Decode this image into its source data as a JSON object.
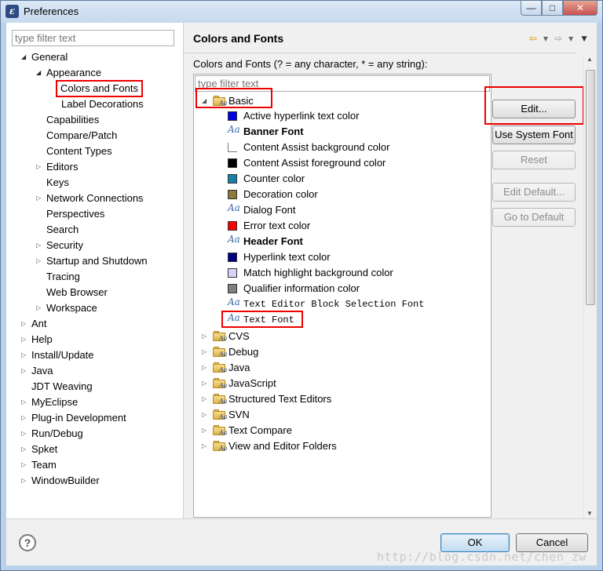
{
  "window": {
    "title": "Preferences",
    "controls": [
      "—",
      "□",
      "✕"
    ]
  },
  "left": {
    "filter_placeholder": "type filter text",
    "tree": [
      {
        "label": "General",
        "level": 0,
        "twisty": "open"
      },
      {
        "label": "Appearance",
        "level": 1,
        "twisty": "open"
      },
      {
        "label": "Colors and Fonts",
        "level": 2,
        "twisty": "none",
        "selected": true
      },
      {
        "label": "Label Decorations",
        "level": 2,
        "twisty": "none"
      },
      {
        "label": "Capabilities",
        "level": 1,
        "twisty": "none"
      },
      {
        "label": "Compare/Patch",
        "level": 1,
        "twisty": "none"
      },
      {
        "label": "Content Types",
        "level": 1,
        "twisty": "none"
      },
      {
        "label": "Editors",
        "level": 1,
        "twisty": "closed"
      },
      {
        "label": "Keys",
        "level": 1,
        "twisty": "none"
      },
      {
        "label": "Network Connections",
        "level": 1,
        "twisty": "closed"
      },
      {
        "label": "Perspectives",
        "level": 1,
        "twisty": "none"
      },
      {
        "label": "Search",
        "level": 1,
        "twisty": "none"
      },
      {
        "label": "Security",
        "level": 1,
        "twisty": "closed"
      },
      {
        "label": "Startup and Shutdown",
        "level": 1,
        "twisty": "closed"
      },
      {
        "label": "Tracing",
        "level": 1,
        "twisty": "none"
      },
      {
        "label": "Web Browser",
        "level": 1,
        "twisty": "none"
      },
      {
        "label": "Workspace",
        "level": 1,
        "twisty": "closed"
      },
      {
        "label": "Ant",
        "level": 0,
        "twisty": "closed"
      },
      {
        "label": "Help",
        "level": 0,
        "twisty": "closed"
      },
      {
        "label": "Install/Update",
        "level": 0,
        "twisty": "closed"
      },
      {
        "label": "Java",
        "level": 0,
        "twisty": "closed"
      },
      {
        "label": "JDT Weaving",
        "level": 0,
        "twisty": "none"
      },
      {
        "label": "MyEclipse",
        "level": 0,
        "twisty": "closed"
      },
      {
        "label": "Plug-in Development",
        "level": 0,
        "twisty": "closed"
      },
      {
        "label": "Run/Debug",
        "level": 0,
        "twisty": "closed"
      },
      {
        "label": "Spket",
        "level": 0,
        "twisty": "closed"
      },
      {
        "label": "Team",
        "level": 0,
        "twisty": "closed"
      },
      {
        "label": "WindowBuilder",
        "level": 0,
        "twisty": "closed"
      }
    ]
  },
  "right": {
    "title": "Colors and Fonts",
    "description": "Colors and Fonts (? = any character, * = any string):",
    "filter_placeholder": "type filter text",
    "basic_label": "Basic",
    "basic_items": [
      {
        "label": "Active hyperlink text color",
        "kind": "color",
        "color": "#0000e0"
      },
      {
        "label": "Banner Font",
        "kind": "font",
        "bold": true
      },
      {
        "label": "Content Assist background color",
        "kind": "color",
        "color": "#ffffff"
      },
      {
        "label": "Content Assist foreground color",
        "kind": "color",
        "color": "#000000"
      },
      {
        "label": "Counter color",
        "kind": "color",
        "color": "#1a7fa8"
      },
      {
        "label": "Decoration color",
        "kind": "color",
        "color": "#8c7a3a"
      },
      {
        "label": "Dialog Font",
        "kind": "font"
      },
      {
        "label": "Error text color",
        "kind": "color",
        "color": "#ff0000"
      },
      {
        "label": "Header Font",
        "kind": "font",
        "bold": true
      },
      {
        "label": "Hyperlink text color",
        "kind": "color",
        "color": "#000080"
      },
      {
        "label": "Match highlight background color",
        "kind": "color",
        "color": "#d4d4f4"
      },
      {
        "label": "Qualifier information color",
        "kind": "color",
        "color": "#808080"
      },
      {
        "label": "Text Editor Block Selection Font",
        "kind": "font",
        "mono": true
      },
      {
        "label": "Text Font",
        "kind": "font",
        "mono": true
      }
    ],
    "categories": [
      "CVS",
      "Debug",
      "Java",
      "JavaScript",
      "Structured Text Editors",
      "SVN",
      "Text Compare",
      "View and Editor Folders"
    ],
    "font_icon_text": "Aa",
    "buttons": {
      "edit": "Edit...",
      "use_system_font": "Use System Font",
      "reset": "Reset",
      "edit_default": "Edit Default...",
      "go_to_default": "Go to Default"
    }
  },
  "footer": {
    "help_icon": "?",
    "ok": "OK",
    "cancel": "Cancel",
    "watermark": "http://blog.csdn.net/chen_zw"
  },
  "colors": {
    "highlight_red": "#e00000",
    "window_frame": "#b9d1ea",
    "dialog_bg": "#f0f0f0"
  }
}
